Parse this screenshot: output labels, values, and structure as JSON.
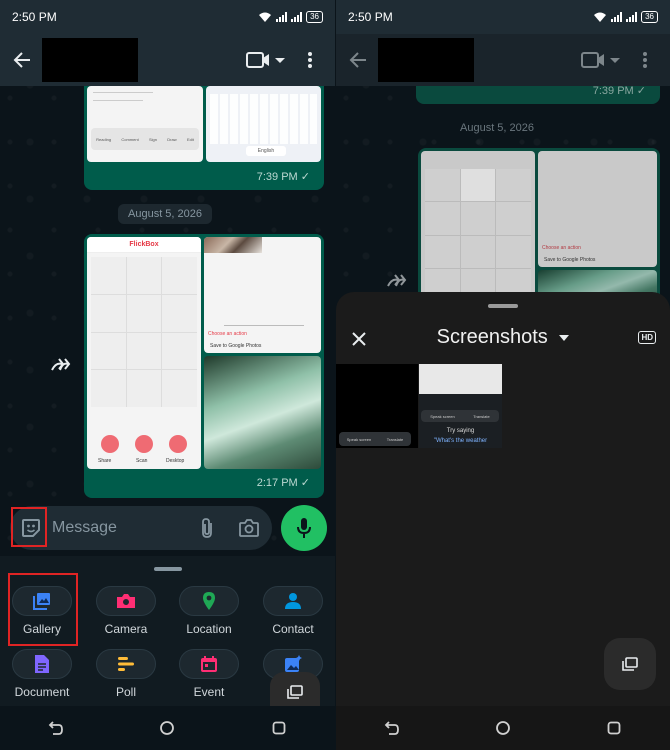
{
  "status_bar": {
    "time": "2:50 PM",
    "battery": "36"
  },
  "left": {
    "date_chip": "August 5, 2026",
    "timestamps": [
      "7:39 PM ✓",
      "2:17 PM ✓"
    ],
    "thumb_texts": {
      "brand": "FlickBox",
      "choose": "Choose an action",
      "save": "Save to Google Photos",
      "share": "Share",
      "scan": "Scan",
      "desktop": "Desktop",
      "english": "English",
      "tool_labels": [
        "Reading",
        "Comment",
        "Sign",
        "Draw",
        "Edit"
      ]
    },
    "message_placeholder": "Message",
    "attach_items": [
      {
        "label": "Gallery",
        "color": "#3b82f6"
      },
      {
        "label": "Camera",
        "color": "#ff2e74"
      },
      {
        "label": "Location",
        "color": "#1fa855"
      },
      {
        "label": "Contact",
        "color": "#0096de"
      },
      {
        "label": "Document",
        "color": "#7f66ff"
      },
      {
        "label": "Poll",
        "color": "#ffbc38"
      },
      {
        "label": "Event",
        "color": "#ff2e74"
      },
      {
        "label": "",
        "color": "#3b82f6"
      }
    ]
  },
  "right": {
    "timestamp": "7:39 PM ✓",
    "date_chip": "August 5, 2026",
    "thumb_texts": {
      "choose": "Choose an action",
      "save": "Save to Google Photos"
    },
    "gallery_title": "Screenshots",
    "hd_label": "HD",
    "shot_texts": {
      "speak": "Speak screen",
      "translate": "Translate",
      "try": "Try saying",
      "weather": "\"What's the weather"
    }
  }
}
